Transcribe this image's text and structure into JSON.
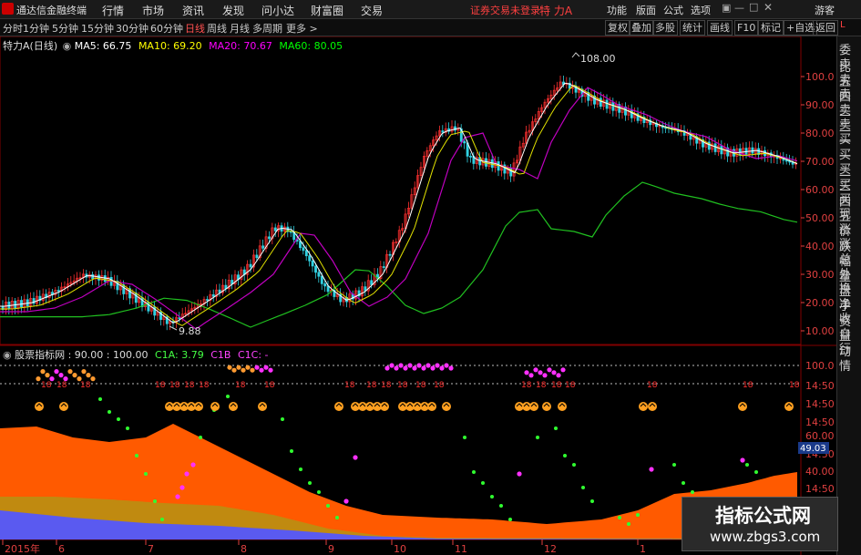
{
  "menubar": {
    "app_title": "通达信金融终端",
    "menus": [
      "行情",
      "市场",
      "资讯",
      "发现",
      "问小达",
      "财富圈",
      "交易"
    ],
    "notice": "证券交易未登录",
    "stock_title": "特 力A",
    "right_menus": [
      "功能",
      "版面",
      "公式",
      "选项"
    ],
    "guest": "游客"
  },
  "toolbar": {
    "periods": [
      "分时",
      "1分钟",
      "5分钟",
      "15分钟",
      "30分钟",
      "60分钟",
      "日线",
      "周线",
      "月线",
      "多周期",
      "更多 >"
    ],
    "active_period": "日线",
    "right_buttons": [
      "复权",
      "叠加",
      "多股",
      "统计",
      "画线",
      "F10",
      "标记",
      "+自选",
      "返回"
    ]
  },
  "main_legend": {
    "name": "特力A(日线)",
    "ma5": "MA5: 66.75",
    "ma10": "MA10: 69.20",
    "ma20": "MA20: 70.67",
    "ma60": "MA60: 80.05",
    "colors": {
      "ma5": "#ffffff",
      "ma10": "#ffff00",
      "ma20": "#ff00ff",
      "ma60": "#00ff00"
    }
  },
  "main_axis": [
    "100.0",
    "90.00",
    "80.00",
    "70.00",
    "60.00",
    "50.00",
    "40.00",
    "30.00",
    "20.00",
    "10.00"
  ],
  "annotations": {
    "high": "108.00",
    "low": "9.88"
  },
  "indicator_legend": {
    "name": "股票指标网",
    "values": ": 90.00 : 100.00",
    "c1a": "C1A: 3.79",
    "c1b": "C1B",
    "c1c": "C1C: -"
  },
  "indicator_axis": [
    "100.0",
    "14:50",
    "14:50",
    "14:50",
    "60.00",
    "14:50",
    "40.00",
    "14:50",
    "14:50"
  ],
  "indicator_current": "49.03",
  "signal_label": "18",
  "date_axis": [
    "2015年",
    "6",
    "7",
    "8",
    "9",
    "10",
    "11",
    "12",
    "1"
  ],
  "right_tabs": [
    "委比",
    "卖五",
    "卖四",
    "卖三",
    "卖二",
    "卖一",
    "买一",
    "买二",
    "买三",
    "买四",
    "买五",
    "现价",
    "涨跌",
    "涨幅",
    "总量",
    "外盘",
    "换手",
    "净资",
    "收益",
    "自动",
    "行情"
  ],
  "watermark": {
    "line1": "指标公式网",
    "line2": "www.zbgs3.com"
  }
}
